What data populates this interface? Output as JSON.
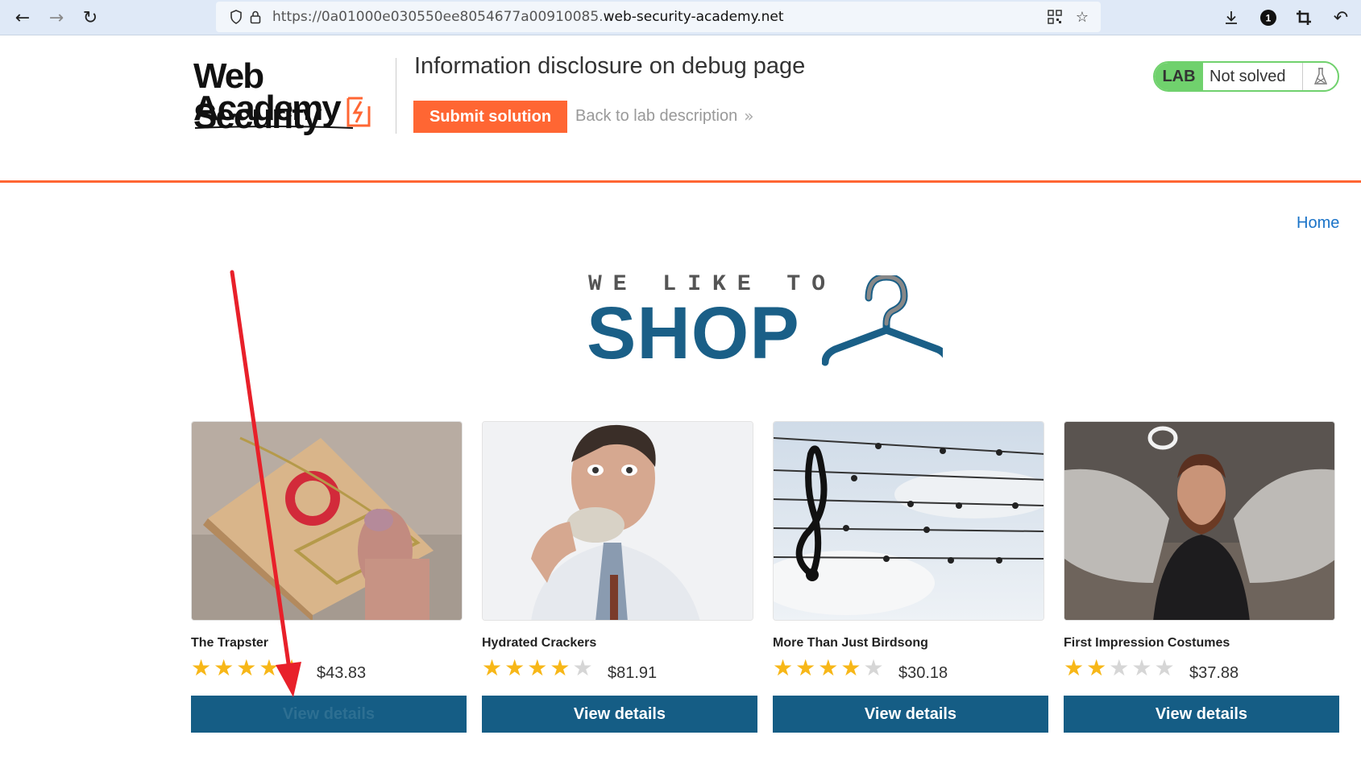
{
  "browser": {
    "url_prefix": "https://0a01000e030550ee8054677a00910085.",
    "url_host": "web-security-academy.net",
    "back_icon": "arrow-left-icon",
    "forward_icon": "arrow-right-icon",
    "reload_icon": "reload-icon"
  },
  "lab_header": {
    "logo_line1": "Web Security",
    "logo_line2": "Academy",
    "title": "Information disclosure on debug page",
    "submit_label": "Submit solution",
    "back_label": "Back to lab description",
    "lab_tag": "LAB",
    "status": "Not solved"
  },
  "nav": {
    "home_label": "Home"
  },
  "banner": {
    "small": "WE LIKE TO",
    "big": "SHOP"
  },
  "products": [
    {
      "name": "The Trapster",
      "rating": 5,
      "price": "$43.83",
      "button": "View details"
    },
    {
      "name": "Hydrated Crackers",
      "rating": 4,
      "price": "$81.91",
      "button": "View details"
    },
    {
      "name": "More Than Just Birdsong",
      "rating": 4,
      "price": "$30.18",
      "button": "View details"
    },
    {
      "name": "First Impression Costumes",
      "rating": 2,
      "price": "$37.88",
      "button": "View details"
    }
  ],
  "colors": {
    "accent_orange": "#ff6633",
    "button_blue": "#155d85",
    "banner_blue": "#1a5f87",
    "lab_green": "#70d16d",
    "star_yellow": "#f7b718",
    "annotation_red": "#e8202a"
  }
}
